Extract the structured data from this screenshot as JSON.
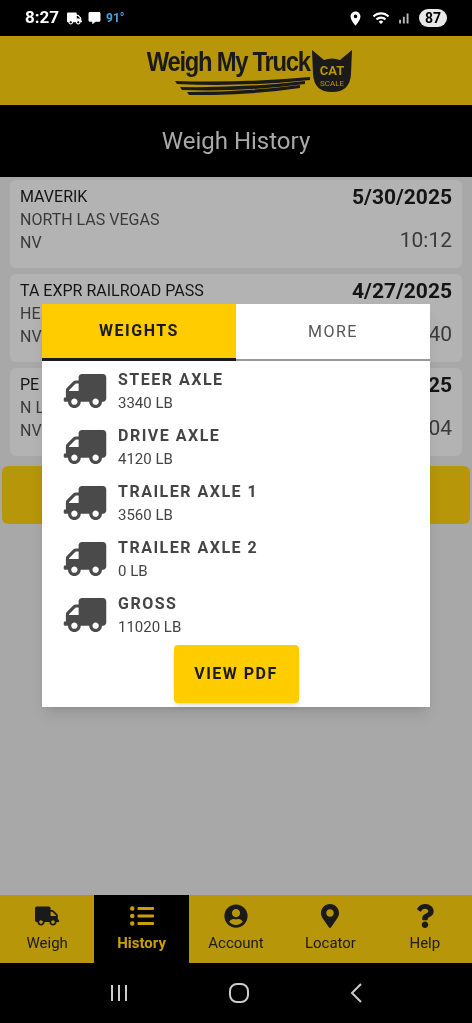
{
  "status_bar": {
    "time": "8:27",
    "temperature": "91°",
    "battery": "87"
  },
  "logo": {
    "text": "Weigh My Truck",
    "badge": "CAT",
    "badge_sub": "SCALE"
  },
  "title": "Weigh History",
  "history": [
    {
      "name": "MAVERIK",
      "city": "NORTH LAS VEGAS",
      "state": "NV",
      "date": "5/30/2025",
      "time": "10:12"
    },
    {
      "name": "TA EXPR RAILROAD PASS",
      "city": "HE",
      "state": "NV",
      "date": "4/27/2025",
      "time": "40"
    },
    {
      "name": "PE",
      "city": "N L",
      "state": "NV",
      "date": "25",
      "time": "04"
    }
  ],
  "dialog": {
    "tabs": [
      {
        "label": "WEIGHTS",
        "selected": true
      },
      {
        "label": "MORE",
        "selected": false
      }
    ],
    "weights": [
      {
        "label": "STEER AXLE",
        "value": "3340 LB"
      },
      {
        "label": "DRIVE AXLE",
        "value": "4120 LB"
      },
      {
        "label": "TRAILER AXLE 1",
        "value": "3560 LB"
      },
      {
        "label": "TRAILER AXLE 2",
        "value": "0 LB"
      },
      {
        "label": "GROSS",
        "value": "11020 LB"
      }
    ],
    "button": "VIEW PDF"
  },
  "nav": [
    {
      "kind": "truck",
      "label": "Weigh",
      "selected": false
    },
    {
      "kind": "list",
      "label": "History",
      "selected": true
    },
    {
      "kind": "account",
      "label": "Account",
      "selected": false
    },
    {
      "kind": "pin",
      "label": "Locator",
      "selected": false
    },
    {
      "kind": "help",
      "label": "Help",
      "selected": false
    }
  ]
}
